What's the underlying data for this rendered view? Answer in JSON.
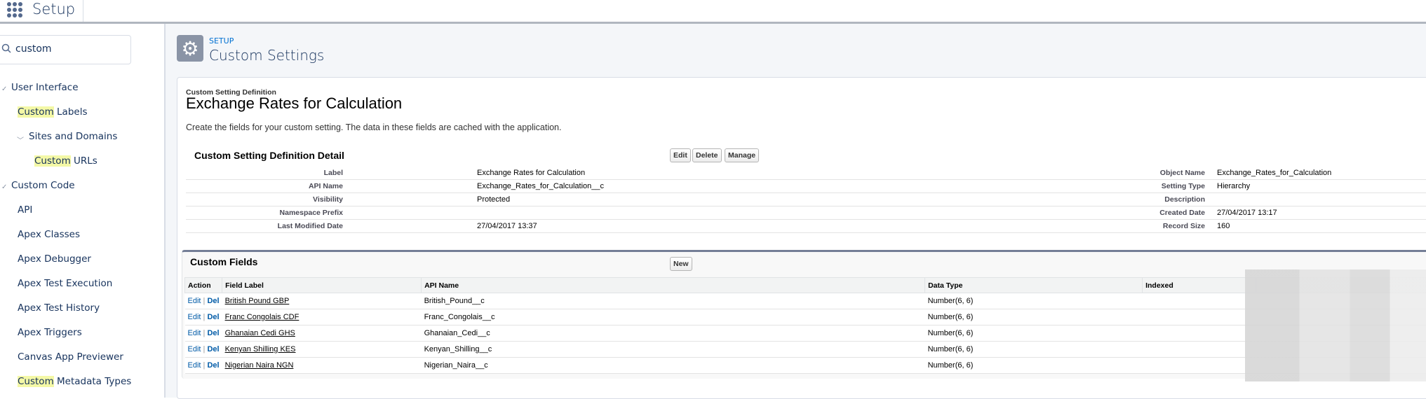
{
  "header": {
    "app_title": "Setup"
  },
  "sidebar": {
    "search_value": "custom",
    "items": [
      {
        "label": "User Interface",
        "highlight": ""
      },
      {
        "highlight": "Custom",
        "label": " Labels"
      },
      {
        "label": "Sites and Domains",
        "highlight": ""
      },
      {
        "highlight": "Custom",
        "label": " URLs"
      },
      {
        "label": "Custom Code",
        "highlight": ""
      },
      {
        "label": "API",
        "highlight": ""
      },
      {
        "label": "Apex Classes",
        "highlight": ""
      },
      {
        "label": "Apex Debugger",
        "highlight": ""
      },
      {
        "label": "Apex Test Execution",
        "highlight": ""
      },
      {
        "label": "Apex Test History",
        "highlight": ""
      },
      {
        "label": "Apex Triggers",
        "highlight": ""
      },
      {
        "label": "Canvas App Previewer",
        "highlight": ""
      },
      {
        "highlight": "Custom",
        "label": " Metadata Types"
      }
    ]
  },
  "page": {
    "breadcrumb": "SETUP",
    "title": "Custom Settings"
  },
  "definition": {
    "subtitle": "Custom Setting Definition",
    "title": "Exchange Rates for Calculation",
    "description": "Create the fields for your custom setting. The data in these fields are cached with the application.",
    "detail_title": "Custom Setting Definition Detail",
    "buttons": {
      "edit": "Edit",
      "delete": "Delete",
      "manage": "Manage"
    },
    "left": [
      {
        "label": "Label",
        "value": "Exchange Rates for Calculation"
      },
      {
        "label": "API Name",
        "value": "Exchange_Rates_for_Calculation__c"
      },
      {
        "label": "Visibility",
        "value": "Protected"
      },
      {
        "label": "Namespace Prefix",
        "value": ""
      },
      {
        "label": "Last Modified Date",
        "value": "27/04/2017 13:37"
      }
    ],
    "right": [
      {
        "label": "Object Name",
        "value": "Exchange_Rates_for_Calculation"
      },
      {
        "label": "Setting Type",
        "value": "Hierarchy"
      },
      {
        "label": "Description",
        "value": ""
      },
      {
        "label": "Created Date",
        "value": "27/04/2017 13:17"
      },
      {
        "label": "Record Size",
        "value": "160"
      }
    ]
  },
  "custom_fields": {
    "title": "Custom Fields",
    "new_label": "New",
    "columns": [
      "Action",
      "Field Label",
      "API Name",
      "Data Type",
      "Indexed"
    ],
    "edit": "Edit",
    "sep": "|",
    "del": "Del",
    "rows": [
      {
        "label": "British Pound GBP",
        "api": "British_Pound__c",
        "type": "Number(6, 6)"
      },
      {
        "label": "Franc Congolais CDF",
        "api": "Franc_Congolais__c",
        "type": "Number(6, 6)"
      },
      {
        "label": "Ghanaian Cedi GHS",
        "api": "Ghanaian_Cedi__c",
        "type": "Number(6, 6)"
      },
      {
        "label": "Kenyan Shilling KES",
        "api": "Kenyan_Shilling__c",
        "type": "Number(6, 6)"
      },
      {
        "label": "Nigerian Naira NGN",
        "api": "Nigerian_Naira__c",
        "type": "Number(6, 6)"
      }
    ]
  }
}
